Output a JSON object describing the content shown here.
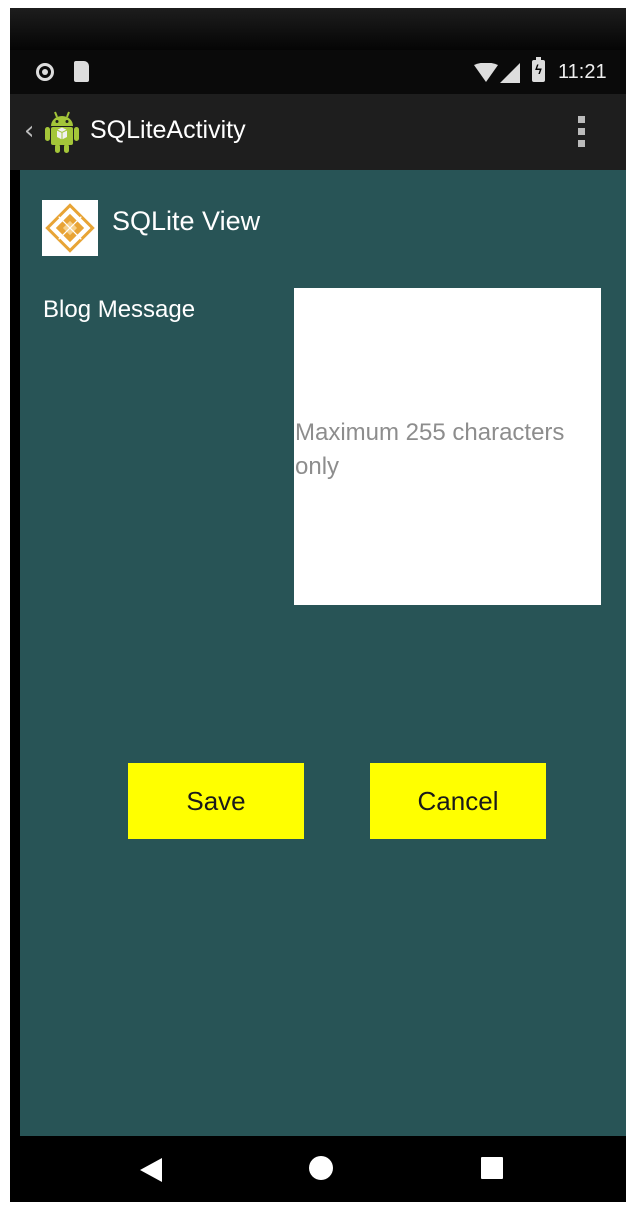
{
  "status_bar": {
    "time": "11:21",
    "battery_glyph": "ϟ",
    "icons": [
      "notification-dot-icon",
      "sd-card-icon",
      "wifi-icon",
      "signal-icon",
      "battery-charging-icon"
    ]
  },
  "action_bar": {
    "back_glyph": "‹",
    "title": "SQLiteActivity",
    "icons": [
      "android-logo-icon",
      "overflow-menu-icon"
    ]
  },
  "header": {
    "title": "SQLite View",
    "icon": "sqlite-logo-icon"
  },
  "form": {
    "blog_label": "Blog Message",
    "message_value": "",
    "message_placeholder": "Maximum 255 characters only"
  },
  "buttons": {
    "save_label": "Save",
    "cancel_label": "Cancel"
  },
  "nav_bar": {
    "icons": [
      "back-icon",
      "home-icon",
      "recents-icon"
    ]
  },
  "colors": {
    "background": "#285456",
    "button": "#ffff00",
    "action_bar": "#1e1e1e",
    "status_bar": "#0a0a0a",
    "android_green": "#a4c639",
    "logo_orange": "#e8a435"
  }
}
